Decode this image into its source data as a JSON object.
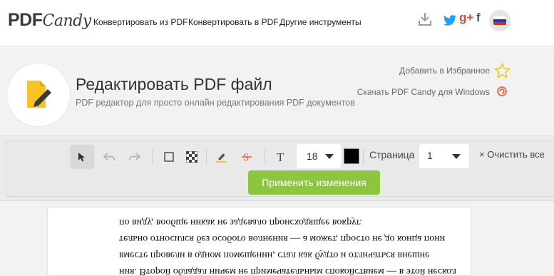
{
  "brand": {
    "pdf": "PDF",
    "candy": "Candy"
  },
  "nav": {
    "items": [
      "Конвертировать из PDF",
      "Конвертировать в PDF",
      "Другие инструменты"
    ]
  },
  "header": {
    "title": "Редактировать PDF файл",
    "subtitle": "PDF редактор для просто онлайн редактирования PDF документов",
    "favorite_label": "Добавить в Избранное",
    "windows_label": "Скачать PDF Candy для Windows"
  },
  "toolbar": {
    "font_size": "18",
    "text_color": "#000000",
    "page_label": "Страница",
    "page_value": "1",
    "clear_label": "× Очистить все",
    "apply_label": "Применить изменения"
  },
  "document": {
    "lines": [
      "по виду, вообще никак не задевало происходящее вокруг.",
      "тельно относился без особого волнения — а может, просто не до конца пони",
      "вместе провели в одном помещении, стал как будто и отличаться внешне",
      "ния. Второй обладал ничем не примечательным спокойствием — в этой нескол"
    ]
  },
  "colors": {
    "accent": "#8cc63f",
    "icon_yellow": "#f6c324",
    "twitter": "#1da1f2",
    "gplus": "#dd4b39",
    "facebook": "#3b5998"
  }
}
